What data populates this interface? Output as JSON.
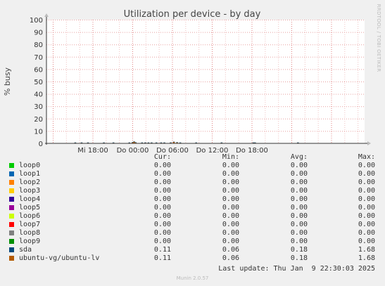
{
  "chart_data": {
    "type": "area",
    "title": "Utilization per device - by day",
    "ylabel": "% busy",
    "ylim": [
      0,
      100
    ],
    "yticks": [
      0,
      10,
      20,
      30,
      40,
      50,
      60,
      70,
      80,
      90,
      100
    ],
    "xticks": [
      "Mi 18:00",
      "Do 00:00",
      "Do 06:00",
      "Do 12:00",
      "Do 18:00"
    ],
    "grid": true,
    "side_label": "RRDTOOL / TOBI OETIKER",
    "series": [
      {
        "name": "loop0",
        "color": "#00cc00"
      },
      {
        "name": "loop1",
        "color": "#0066b3"
      },
      {
        "name": "loop2",
        "color": "#ff8000"
      },
      {
        "name": "loop3",
        "color": "#ffcc00"
      },
      {
        "name": "loop4",
        "color": "#330099"
      },
      {
        "name": "loop5",
        "color": "#990099"
      },
      {
        "name": "loop6",
        "color": "#ccff00"
      },
      {
        "name": "loop7",
        "color": "#ff0000"
      },
      {
        "name": "loop8",
        "color": "#808080"
      },
      {
        "name": "loop9",
        "color": "#008f00"
      },
      {
        "name": "sda",
        "color": "#00487d"
      },
      {
        "name": "ubuntu-vg/ubuntu-lv",
        "color": "#b35a00"
      }
    ],
    "activity_blips": [
      {
        "t": 0.09,
        "v": 0.3
      },
      {
        "t": 0.11,
        "v": 0.3
      },
      {
        "t": 0.13,
        "v": 0.3
      },
      {
        "t": 0.18,
        "v": 0.5
      },
      {
        "t": 0.21,
        "v": 0.4
      },
      {
        "t": 0.26,
        "v": 0.3
      },
      {
        "t": 0.27,
        "v": 0.8
      },
      {
        "t": 0.275,
        "v": 1.4
      },
      {
        "t": 0.28,
        "v": 0.7
      },
      {
        "t": 0.3,
        "v": 0.4
      },
      {
        "t": 0.31,
        "v": 0.5
      },
      {
        "t": 0.32,
        "v": 0.4
      },
      {
        "t": 0.33,
        "v": 0.4
      },
      {
        "t": 0.345,
        "v": 0.3
      },
      {
        "t": 0.36,
        "v": 0.4
      },
      {
        "t": 0.37,
        "v": 0.4
      },
      {
        "t": 0.39,
        "v": 0.6
      },
      {
        "t": 0.4,
        "v": 1.2
      },
      {
        "t": 0.41,
        "v": 0.8
      },
      {
        "t": 0.42,
        "v": 0.4
      },
      {
        "t": 0.47,
        "v": 0.3
      },
      {
        "t": 0.55,
        "v": 0.3
      },
      {
        "t": 0.65,
        "v": 0.4
      },
      {
        "t": 0.655,
        "v": 0.5
      },
      {
        "t": 0.79,
        "v": 0.3
      }
    ]
  },
  "legend": {
    "headers": {
      "cur": "Cur:",
      "min": "Min:",
      "avg": "Avg:",
      "max": "Max:"
    },
    "rows": [
      {
        "name": "loop0",
        "cur": "0.00",
        "min": "0.00",
        "avg": "0.00",
        "max": "0.00"
      },
      {
        "name": "loop1",
        "cur": "0.00",
        "min": "0.00",
        "avg": "0.00",
        "max": "0.00"
      },
      {
        "name": "loop2",
        "cur": "0.00",
        "min": "0.00",
        "avg": "0.00",
        "max": "0.00"
      },
      {
        "name": "loop3",
        "cur": "0.00",
        "min": "0.00",
        "avg": "0.00",
        "max": "0.00"
      },
      {
        "name": "loop4",
        "cur": "0.00",
        "min": "0.00",
        "avg": "0.00",
        "max": "0.00"
      },
      {
        "name": "loop5",
        "cur": "0.00",
        "min": "0.00",
        "avg": "0.00",
        "max": "0.00"
      },
      {
        "name": "loop6",
        "cur": "0.00",
        "min": "0.00",
        "avg": "0.00",
        "max": "0.00"
      },
      {
        "name": "loop7",
        "cur": "0.00",
        "min": "0.00",
        "avg": "0.00",
        "max": "0.00"
      },
      {
        "name": "loop8",
        "cur": "0.00",
        "min": "0.00",
        "avg": "0.00",
        "max": "0.00"
      },
      {
        "name": "loop9",
        "cur": "0.00",
        "min": "0.00",
        "avg": "0.00",
        "max": "0.00"
      },
      {
        "name": "sda",
        "cur": "0.11",
        "min": "0.06",
        "avg": "0.18",
        "max": "1.68"
      },
      {
        "name": "ubuntu-vg/ubuntu-lv",
        "cur": "0.11",
        "min": "0.06",
        "avg": "0.18",
        "max": "1.68"
      }
    ]
  },
  "last_update": "Last update: Thu Jan  9 22:30:03 2025",
  "footer": "Munin 2.0.57"
}
